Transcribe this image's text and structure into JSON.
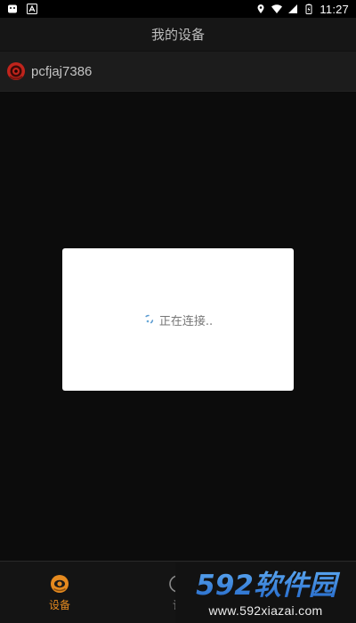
{
  "status_bar": {
    "time": "11:27",
    "icons": [
      "notification-icon",
      "a-icon",
      "location-icon",
      "wifi-icon",
      "signal-icon",
      "battery-icon"
    ]
  },
  "header": {
    "title": "我的设备"
  },
  "device": {
    "name": "pcfjaj7386",
    "icon": "camera-icon"
  },
  "dialog": {
    "message": "正在连接..",
    "icon": "spinner-icon"
  },
  "bottom_nav": {
    "items": [
      {
        "label": "设备",
        "icon": "eye-camera-icon",
        "active": true
      },
      {
        "label": "记",
        "icon": "clock-icon",
        "active": false
      }
    ]
  },
  "watermark": {
    "brand": "592软件园",
    "url": "www.592xiazai.com"
  },
  "colors": {
    "accent": "#e58a1f",
    "watermark_blue": "#2f7ee0"
  }
}
